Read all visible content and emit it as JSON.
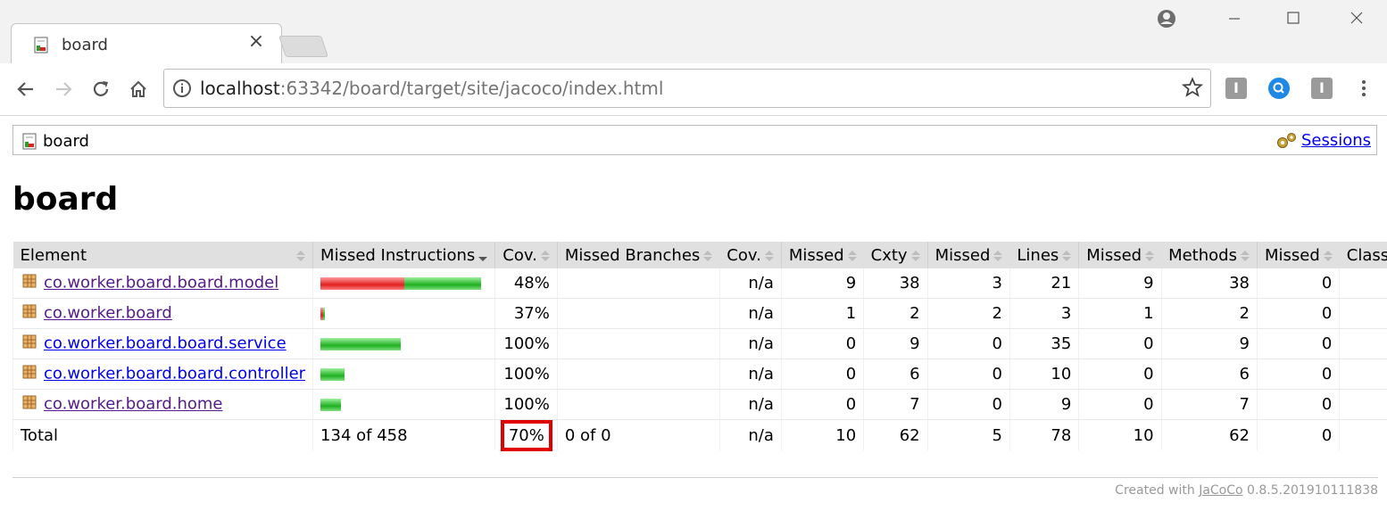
{
  "browser": {
    "tab_title": "board",
    "url_host": "localhost",
    "url_rest": ":63342/board/target/site/jacoco/index.html"
  },
  "breadcrumb": {
    "label": "board",
    "sessions": "Sessions"
  },
  "page_title": "board",
  "table": {
    "headers": [
      "Element",
      "Missed Instructions",
      "Cov.",
      "Missed Branches",
      "Cov.",
      "Missed",
      "Cxty",
      "Missed",
      "Lines",
      "Missed",
      "Methods",
      "Missed",
      "Classes"
    ],
    "rows": [
      {
        "name": "co.worker.board.board.model",
        "missed_fraction": 0.52,
        "cov": "48%",
        "branch_cov": "n/a",
        "missed_cxty": "9",
        "cxty": "38",
        "missed_lines": "3",
        "lines": "21",
        "missed_methods": "9",
        "methods": "38",
        "missed_classes": "0"
      },
      {
        "name": "co.worker.board",
        "missed_fraction": 0.63,
        "cov": "37%",
        "branch_cov": "n/a",
        "missed_cxty": "1",
        "cxty": "2",
        "missed_lines": "2",
        "lines": "3",
        "missed_methods": "1",
        "methods": "2",
        "missed_classes": "0"
      },
      {
        "name": "co.worker.board.board.service",
        "missed_fraction": 0,
        "cov": "100%",
        "branch_cov": "n/a",
        "missed_cxty": "0",
        "cxty": "9",
        "missed_lines": "0",
        "lines": "35",
        "missed_methods": "0",
        "methods": "9",
        "missed_classes": "0"
      },
      {
        "name": "co.worker.board.board.controller",
        "missed_fraction": 0,
        "cov": "100%",
        "branch_cov": "n/a",
        "missed_cxty": "0",
        "cxty": "6",
        "missed_lines": "0",
        "lines": "10",
        "missed_methods": "0",
        "methods": "6",
        "missed_classes": "0"
      },
      {
        "name": "co.worker.board.home",
        "missed_fraction": 0,
        "cov": "100%",
        "branch_cov": "n/a",
        "missed_cxty": "0",
        "cxty": "7",
        "missed_lines": "0",
        "lines": "9",
        "missed_methods": "0",
        "methods": "7",
        "missed_classes": "0"
      }
    ],
    "total": {
      "label": "Total",
      "instructions": "134 of 458",
      "cov": "70%",
      "branches": "0 of 0",
      "branch_cov": "n/a",
      "missed_cxty": "10",
      "cxty": "62",
      "missed_lines": "5",
      "lines": "78",
      "missed_methods": "10",
      "methods": "62",
      "missed_classes": "0"
    }
  },
  "footer": {
    "prefix": "Created with",
    "link": "JaCoCo",
    "version": "0.8.5.201910111838"
  },
  "colors": {
    "covered": "#20b020",
    "missed": "#e02020",
    "highlight": "#e00000",
    "link": "#0000ee"
  }
}
